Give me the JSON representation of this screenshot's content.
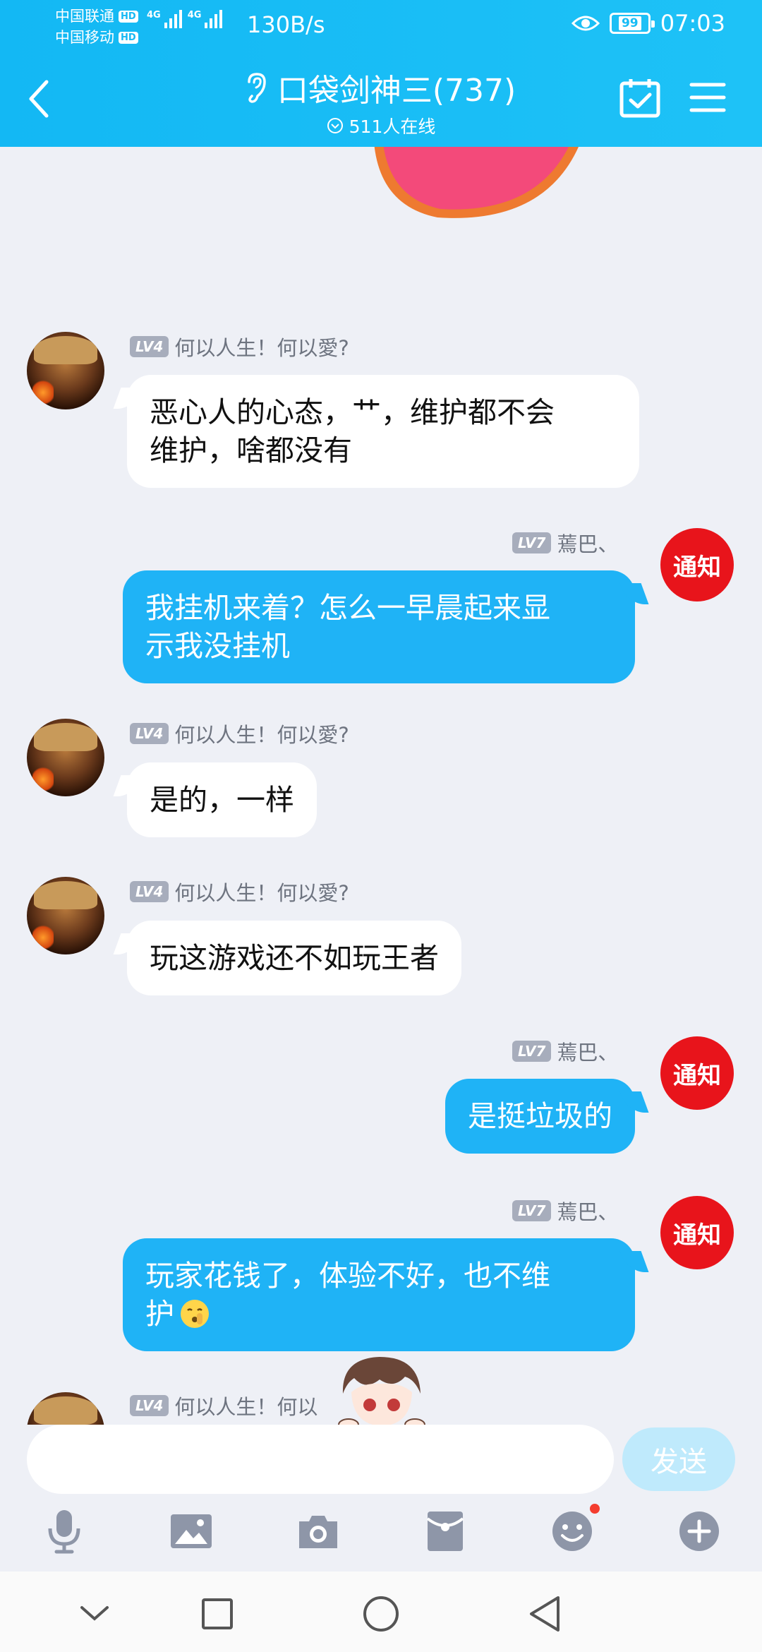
{
  "status_bar": {
    "carrier1": "中国联通",
    "carrier2": "中国移动",
    "hd": "HD",
    "net_type": "4G",
    "net_speed": "130B/s",
    "battery": "99",
    "time": "07:03"
  },
  "header": {
    "title": "口袋剑神三(737)",
    "online": "511人在线"
  },
  "messages": [
    {
      "side": "left",
      "level": "LV4",
      "name": "何以人生！何以愛?",
      "text_line1": "恶心人的心态，艹，维护都不会",
      "text_line2": "维护，啥都没有"
    },
    {
      "side": "right",
      "level": "LV7",
      "name": "蔫巴、",
      "text_line1": "我挂机来着？怎么一早晨起来显",
      "text_line2": "示我没挂机"
    },
    {
      "side": "left",
      "level": "LV4",
      "name": "何以人生！何以愛?",
      "text": "是的，一样"
    },
    {
      "side": "left",
      "level": "LV4",
      "name": "何以人生！何以愛?",
      "text": "玩这游戏还不如玩王者"
    },
    {
      "side": "right",
      "level": "LV7",
      "name": "蔫巴、",
      "text": "是挺垃圾的"
    },
    {
      "side": "right",
      "level": "LV7",
      "name": "蔫巴、",
      "text_line1": "玩家花钱了，体验不好，也不维",
      "text_line2": "护"
    },
    {
      "side": "left",
      "level": "LV4",
      "name": "何以人生！何以"
    }
  ],
  "notice_avatar_label": "通知",
  "input": {
    "placeholder": "",
    "send_label": "发送"
  },
  "toolbar": [
    "mic-icon",
    "image-icon",
    "camera-icon",
    "red-packet-icon",
    "emoji-icon",
    "plus-icon"
  ],
  "colors": {
    "header": "#16b9f4",
    "bubble_right": "#1fb3f6",
    "notice_red": "#e8141b",
    "chat_bg": "#eef0f6"
  }
}
